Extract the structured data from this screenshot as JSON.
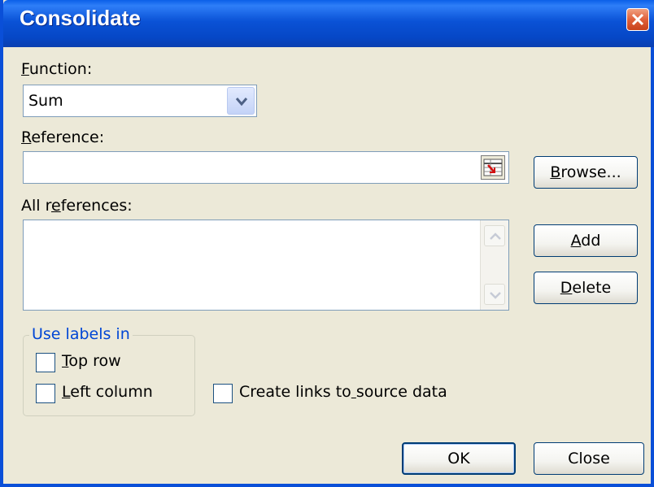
{
  "window": {
    "title": "Consolidate"
  },
  "function": {
    "label": "Function:",
    "value": "Sum"
  },
  "reference": {
    "label": "Reference:",
    "value": ""
  },
  "all_references": {
    "label": "All references:",
    "items": []
  },
  "buttons": {
    "browse": "Browse...",
    "add": "Add",
    "delete": "Delete",
    "ok": "OK",
    "close": "Close"
  },
  "use_labels": {
    "legend": "Use labels in",
    "top_row": "Top row",
    "left_column": "Left column",
    "top_row_checked": false,
    "left_column_checked": false
  },
  "create_links": {
    "label": "Create links to source data",
    "checked": false
  },
  "colors": {
    "title_bar": "#0a52d6",
    "dialog_bg": "#ece9d8",
    "group_legend": "#0046d5",
    "close_button": "#e0603a"
  }
}
